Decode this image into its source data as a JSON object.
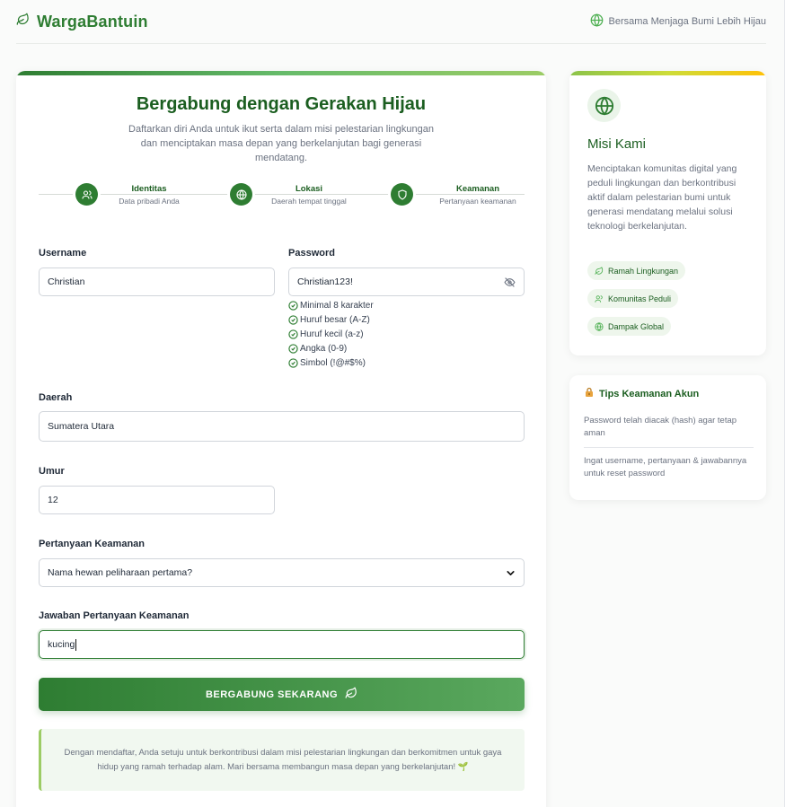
{
  "header": {
    "brand": "WargaBantuin",
    "tagline": "Bersama Menjaga Bumi Lebih Hijau"
  },
  "hero": {
    "title": "Bergabung dengan Gerakan Hijau",
    "subtitle": "Daftarkan diri Anda untuk ikut serta dalam misi pelestarian lingkungan dan menciptakan masa depan yang berkelanjutan bagi generasi mendatang."
  },
  "steps": [
    {
      "title": "Identitas",
      "desc": "Data pribadi Anda",
      "icon": "users-icon"
    },
    {
      "title": "Lokasi",
      "desc": "Daerah tempat tinggal",
      "icon": "globe-icon"
    },
    {
      "title": "Keamanan",
      "desc": "Pertanyaan keamanan",
      "icon": "shield-icon"
    }
  ],
  "form": {
    "username_label": "Username",
    "username_value": "Christian",
    "password_label": "Password",
    "password_value": "Christian123!",
    "requirements": [
      "Minimal 8 karakter",
      "Huruf besar (A-Z)",
      "Huruf kecil (a-z)",
      "Angka (0-9)",
      "Simbol (!@#$%)"
    ],
    "region_label": "Daerah",
    "region_value": "Sumatera Utara",
    "age_label": "Umur",
    "age_value": "12",
    "question_label": "Pertanyaan Keamanan",
    "question_value": "Nama hewan peliharaan pertama?",
    "answer_label": "Jawaban Pertanyaan Keamanan",
    "answer_value": "kucing",
    "submit_label": "BERGABUNG SEKARANG",
    "agreement": "Dengan mendaftar, Anda setuju untuk berkontribusi dalam misi pelestarian lingkungan dan berkomitmen untuk gaya hidup yang ramah terhadap alam. Mari bersama membangun masa depan yang berkelanjutan! 🌱"
  },
  "mission": {
    "title": "Misi Kami",
    "text": "Menciptakan komunitas digital yang peduli lingkungan dan berkontribusi aktif dalam pelestarian bumi untuk generasi mendatang melalui solusi teknologi berkelanjutan.",
    "chips": [
      "Ramah Lingkungan",
      "Komunitas Peduli",
      "Dampak Global"
    ]
  },
  "tips": {
    "title": "Tips Keamanan Akun",
    "items": [
      "Password telah diacak (hash) agar tetap aman",
      "Ingat username, pertanyaan & jawabannya untuk reset password"
    ]
  },
  "colors": {
    "primary": "#2e7d32",
    "dark": "#1b5e20",
    "light": "#eef6ec"
  }
}
